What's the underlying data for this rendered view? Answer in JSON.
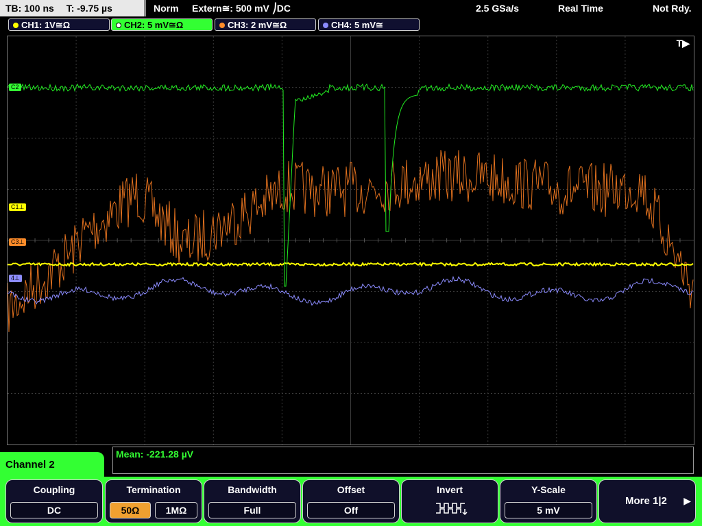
{
  "status_bar": {
    "timebase": "TB: 100 ns",
    "trigger_time": "T: -9.75 µs",
    "mode": "Norm",
    "trigger_source": "Extern≅: 500 mV ⎠DC",
    "sample_rate": "2.5 GSa/s",
    "acquisition": "Real Time",
    "state": "Not Rdy."
  },
  "channels": [
    {
      "label": "CH1: 1V≅Ω",
      "color": "#ffff00"
    },
    {
      "label": "CH2: 5 mV≅Ω",
      "color": "#33ff33"
    },
    {
      "label": "CH3: 2 mV≅Ω",
      "color": "#ff8c2a"
    },
    {
      "label": "CH4: 5 mV≅",
      "color": "#8c8cff"
    }
  ],
  "plot": {
    "trigger_marker": "T▶",
    "markers": {
      "c1": "C1⊥",
      "c3": "C3⊥",
      "c4": "4⊥",
      "c2": "C2"
    }
  },
  "measurement": {
    "text": "Mean: -221.28 µV"
  },
  "channel_menu": {
    "label": "Channel 2"
  },
  "softkeys": {
    "coupling": {
      "title": "Coupling",
      "value": "DC"
    },
    "termination": {
      "title": "Termination",
      "opt1": "50Ω",
      "opt2": "1MΩ"
    },
    "bandwidth": {
      "title": "Bandwidth",
      "value": "Full"
    },
    "offset": {
      "title": "Offset",
      "value": "Off"
    },
    "invert": {
      "title": "Invert",
      "icon": "invert-waveform-icon"
    },
    "yscale": {
      "title": "Y-Scale",
      "value": "5 mV"
    },
    "more": {
      "label": "More 1|2"
    }
  }
}
